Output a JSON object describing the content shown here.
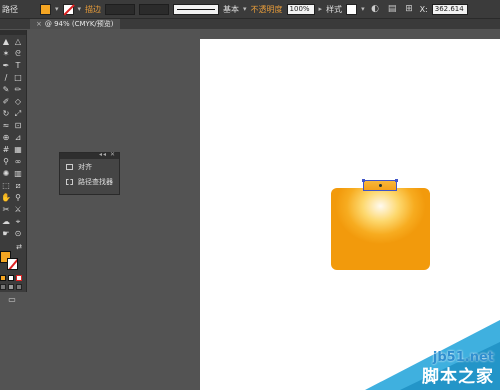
{
  "control_bar": {
    "left_label": "路径",
    "stroke_label": "描边",
    "stroke_profile": "基本",
    "opacity_label": "不透明度",
    "opacity_value": "100%",
    "style_label": "样式",
    "coord_value": "362.614"
  },
  "document": {
    "tab_title": "@ 94% (CMYK/预览)"
  },
  "floating_panel": {
    "items": [
      {
        "label": "对齐",
        "icon": "align-icon"
      },
      {
        "label": "路径查找器",
        "icon": "pathfinder-icon"
      }
    ]
  },
  "colors": {
    "fill": "#f5a623",
    "stroke": "none",
    "selection": "#3f55c8"
  },
  "watermark": {
    "site": "jb51.net",
    "text": "脚本之家"
  }
}
